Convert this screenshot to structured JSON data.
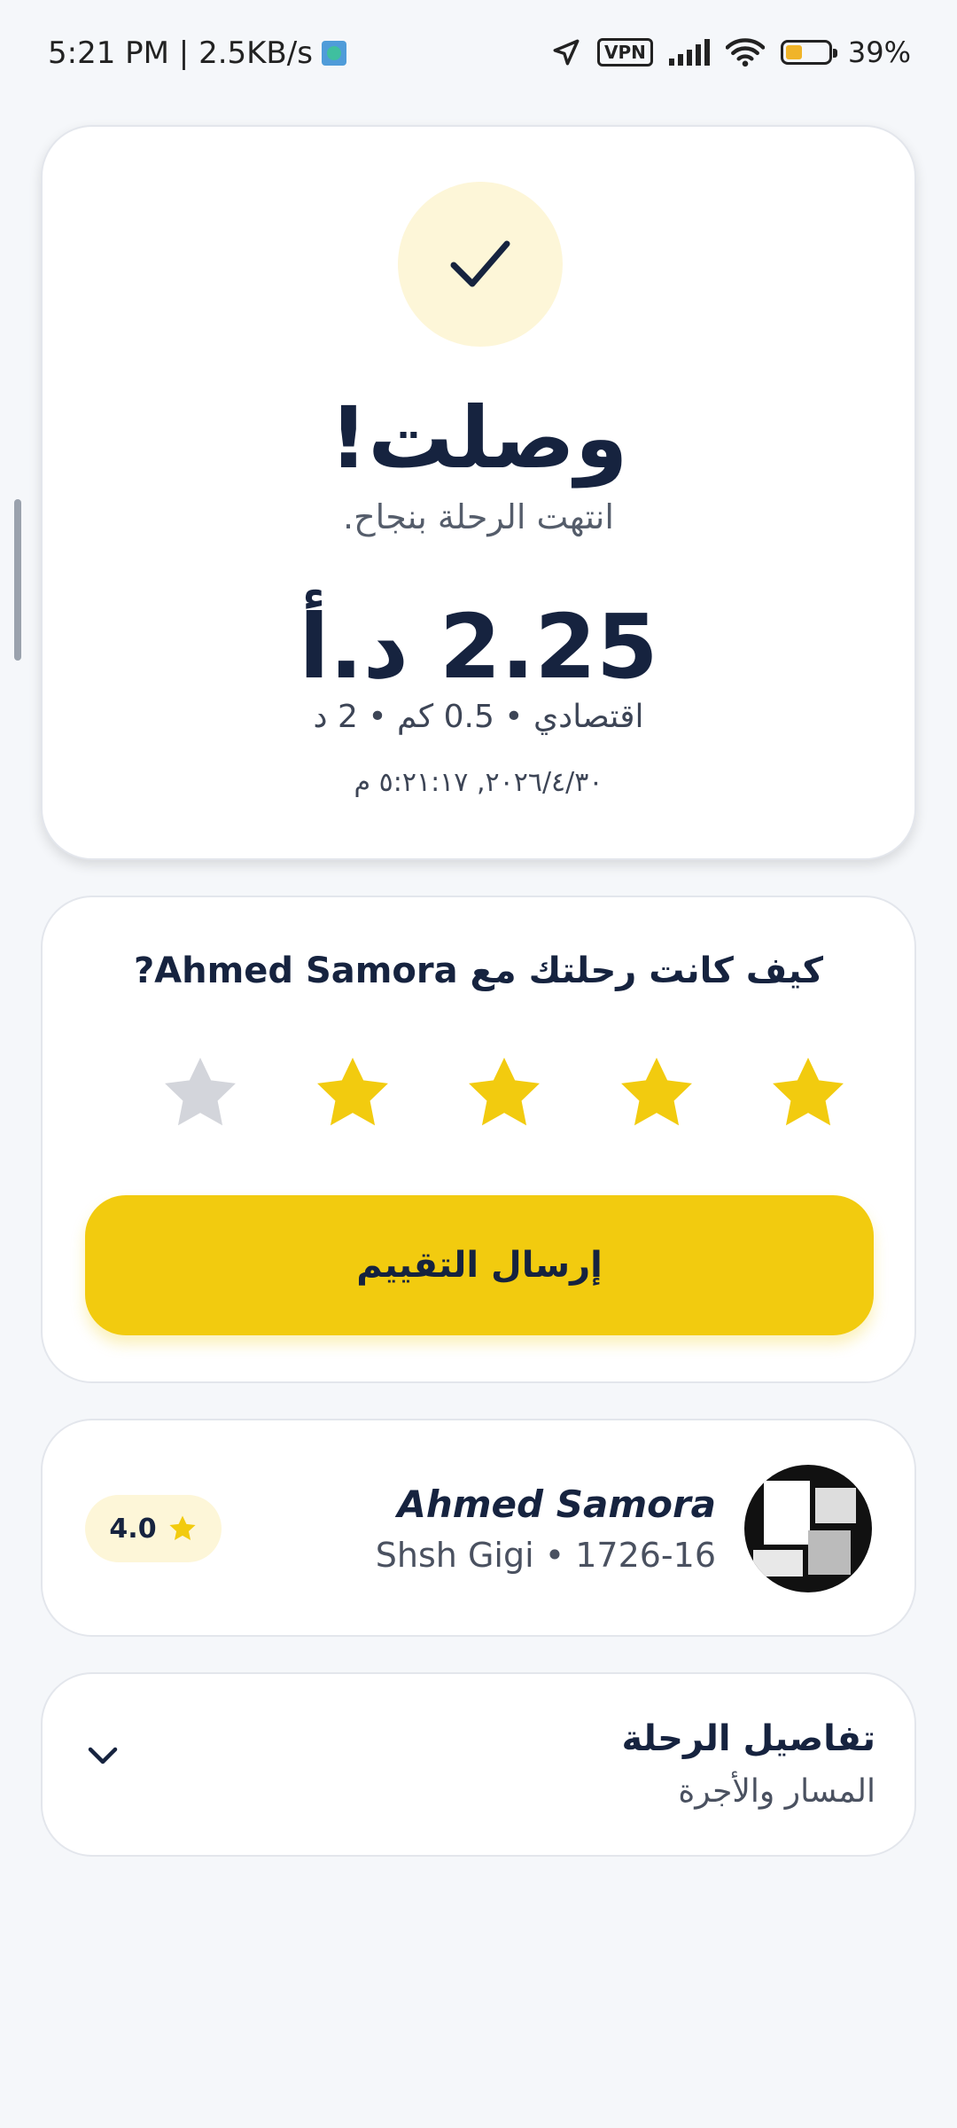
{
  "status_bar": {
    "time_speed": "5:21 PM | 2.5KB/s",
    "vpn": "VPN",
    "battery": "39%",
    "battery_level": 0.39
  },
  "arrival": {
    "title": "وصلت!",
    "subtitle": "انتهت الرحلة بنجاح.",
    "fare": "2.25 د.أ",
    "meta": "اقتصادي • 0.5 كم • 2 د",
    "datetime": "٢٠٢٦/٤/٣٠, ٥:٢١:١٧ م"
  },
  "rating": {
    "question": "كيف كانت رحلتك مع Ahmed Samora?",
    "stars_total": 5,
    "stars_selected": 4,
    "submit_label": "إرسال التقييم",
    "colors": {
      "active": "#F2CB0F",
      "inactive": "#D3D5DB"
    }
  },
  "driver": {
    "name": "Ahmed Samora",
    "vehicle": "Shsh Gigi • 1726-16",
    "rating": "4.0"
  },
  "trip_details": {
    "title": "تفاصيل الرحلة",
    "subtitle": "المسار والأجرة"
  },
  "colors": {
    "accent": "#F2CB0F",
    "text_primary": "#16233F",
    "background": "#F5F7FA"
  }
}
